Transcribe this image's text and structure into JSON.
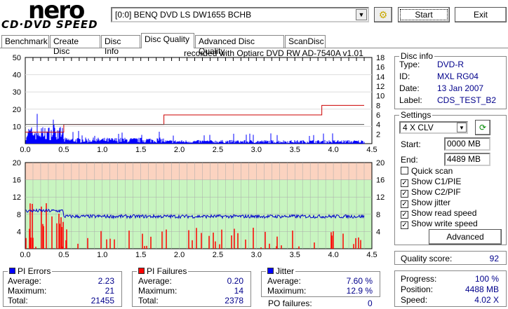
{
  "app": {
    "logo_top": "nero",
    "logo_bottom": "CD·DVD SPEED",
    "drive": "[0:0]  BENQ DVD LS DW1655 BCHB",
    "start": "Start",
    "exit": "Exit"
  },
  "tabs": [
    "Benchmark",
    "Create Disc",
    "Disc Info",
    "Disc Quality",
    "Advanced Disc Quality",
    "ScanDisc"
  ],
  "active_tab": 3,
  "recorded_with": "recorded with Optiarc DVD RW AD-7540A  v1.01",
  "disc_info": {
    "title": "Disc info",
    "type_label": "Type:",
    "type": "DVD-R",
    "id_label": "ID:",
    "id": "MXL RG04",
    "date_label": "Date:",
    "date": "13 Jan 2007",
    "label_label": "Label:",
    "label": "CDS_TEST_B2"
  },
  "settings": {
    "title": "Settings",
    "speed": "4 X CLV",
    "start_label": "Start:",
    "start": "0000 MB",
    "end_label": "End:",
    "end": "4489 MB",
    "checks": [
      {
        "label": "Quick scan",
        "checked": false
      },
      {
        "label": "Show C1/PIE",
        "checked": true
      },
      {
        "label": "Show C2/PIF",
        "checked": true
      },
      {
        "label": "Show jitter",
        "checked": true
      },
      {
        "label": "Show read speed",
        "checked": true
      },
      {
        "label": "Show write speed",
        "checked": true
      }
    ],
    "advanced": "Advanced"
  },
  "quality": {
    "label": "Quality score:",
    "value": "92"
  },
  "progress": {
    "progress_label": "Progress:",
    "progress": "100 %",
    "position_label": "Position:",
    "position": "4488 MB",
    "speed_label": "Speed:",
    "speed": "4.02 X"
  },
  "pi_errors": {
    "title": "PI Errors",
    "avg_label": "Average:",
    "avg": "2.23",
    "max_label": "Maximum:",
    "max": "21",
    "total_label": "Total:",
    "total": "21455"
  },
  "pi_failures": {
    "title": "PI Failures",
    "avg_label": "Average:",
    "avg": "0.20",
    "max_label": "Maximum:",
    "max": "14",
    "total_label": "Total:",
    "total": "2378"
  },
  "jitter": {
    "title": "Jitter",
    "avg_label": "Average:",
    "avg": "7.60 %",
    "max_label": "Maximum:",
    "max": "12.9 %",
    "po_label": "PO failures:",
    "po": "0"
  },
  "colors": {
    "pie": "#0000ff",
    "pif": "#ff0000",
    "jitter": "#0000cc",
    "speed": "#cc0000",
    "green": "#c8f5c0",
    "orange": "#fbd3c0"
  },
  "chart_data": [
    {
      "type": "bar",
      "name": "PI errors",
      "x_ticks": [
        "0.0",
        "0.5",
        "1.0",
        "1.5",
        "2.0",
        "2.5",
        "3.0",
        "3.5",
        "4.0",
        "4.5"
      ],
      "y_ticks_left": [
        "10",
        "20",
        "30",
        "40",
        "50"
      ],
      "y_ticks_right": [
        "2",
        "4",
        "6",
        "8",
        "10",
        "12",
        "14",
        "16",
        "18"
      ],
      "ylim": [
        0,
        50
      ],
      "y2lim": [
        0,
        18
      ],
      "xlim": [
        0,
        4.5
      ],
      "read_speed": [
        [
          0,
          2.4
        ],
        [
          0.5,
          2.4
        ],
        [
          0.5,
          4
        ],
        [
          1.8,
          4
        ],
        [
          1.8,
          6
        ],
        [
          3.85,
          6
        ],
        [
          3.85,
          8
        ],
        [
          4.2,
          8
        ],
        [
          4.4,
          8
        ]
      ]
    },
    {
      "type": "bar",
      "name": "PI failures + jitter",
      "x_ticks": [
        "0.0",
        "0.5",
        "1.0",
        "1.5",
        "2.0",
        "2.5",
        "3.0",
        "3.5",
        "4.0",
        "4.5"
      ],
      "y_ticks": [
        "4",
        "8",
        "12",
        "16",
        "20"
      ],
      "ylim": [
        0,
        20
      ],
      "xlim": [
        0,
        4.5
      ],
      "jitter": [
        [
          0,
          9
        ],
        [
          0.2,
          8.7
        ],
        [
          0.3,
          9.5
        ],
        [
          0.5,
          8.7
        ],
        [
          0.5,
          7.6
        ],
        [
          1.5,
          7.4
        ],
        [
          2.5,
          7.7
        ],
        [
          3.5,
          7.5
        ],
        [
          4.4,
          7.4
        ]
      ]
    }
  ]
}
